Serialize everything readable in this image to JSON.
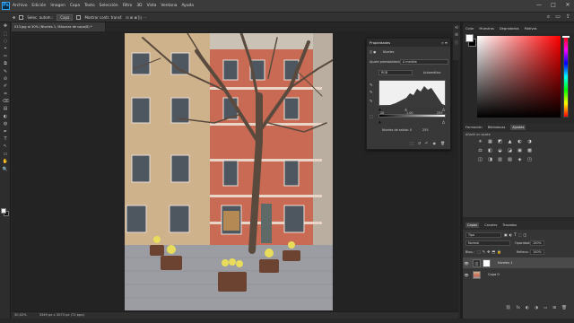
{
  "menubar": {
    "logo": "Ps",
    "items": [
      "Archivo",
      "Edición",
      "Imagen",
      "Capa",
      "Texto",
      "Selección",
      "Filtro",
      "3D",
      "Vista",
      "Ventana",
      "Ayuda"
    ]
  },
  "window_controls": [
    "—",
    "□",
    "✕"
  ],
  "options": {
    "tool_icon": "move-icon",
    "auto_select_label": "Selec. autom.:",
    "auto_select_value": "Capa",
    "transform_label": "Mostrar contr. transf."
  },
  "options_right": [
    "⌕",
    "▭",
    "⇪"
  ],
  "tools": [
    "✥",
    "⬚",
    "◌",
    "⌖",
    "✂",
    "⧉",
    "✎",
    "⊘",
    "✐",
    "♒",
    "⌫",
    "▤",
    "◐",
    "◍",
    "✒",
    "T",
    "↖",
    "▭",
    "✋",
    "🔍"
  ],
  "document_tab": "013.jpg al 30% (Niveles 1, Máscara de capa/8) *",
  "status": {
    "zoom": "30,02%",
    "doc": "3349 px x 3073 px (72 ppp)"
  },
  "properties": {
    "title": "Propiedades",
    "panel_icons": "»  ≡",
    "layer_type": "Niveles",
    "preset_label": "Ajuste preestablecido:",
    "preset_value": "A medida",
    "channel_value": "RGB",
    "auto_label": "Automático",
    "input_values": [
      "20",
      "1,00",
      "255"
    ],
    "output_label": "Niveles de salida:",
    "output_values": [
      "0",
      "255"
    ],
    "footer_icons": [
      "⬚",
      "↺",
      "↶",
      "◉",
      "🗑"
    ]
  },
  "color_panel": {
    "tabs": [
      "Color",
      "Muestras",
      "Degradados",
      "Motivos"
    ],
    "fg_color": "#ffffff",
    "bg_color": "#000000",
    "hue_color": "#ff0000"
  },
  "adjust_panel": {
    "tabs": [
      "Formación",
      "Bibliotecas",
      "Ajustes"
    ],
    "active_tab": "Ajustes",
    "add_label": "Añadir un ajuste",
    "icons": [
      "☀",
      "▦",
      "◩",
      "▲",
      "◐",
      "◑",
      "⚖",
      "◧",
      "◒",
      "◪",
      "▣",
      "▩",
      "◫",
      "◨",
      "▥",
      "▧",
      "◈",
      "◳"
    ]
  },
  "layers_panel": {
    "tabs": [
      "Capas",
      "Canales",
      "Trazados"
    ],
    "active_tab": "Capas",
    "filter": "Tipo",
    "blend_mode": "Normal",
    "opacity_label": "Opacidad:",
    "opacity": "100%",
    "lock_label": "Bloq.:",
    "fill_label": "Relleno:",
    "fill": "100%",
    "layers": [
      {
        "name": "Niveles 1",
        "selected": true
      },
      {
        "name": "Capa 0",
        "selected": false
      }
    ],
    "footer_icons": [
      "⛓",
      "fx",
      "◐",
      "◑",
      "▭",
      "⊞",
      "🗑"
    ]
  }
}
